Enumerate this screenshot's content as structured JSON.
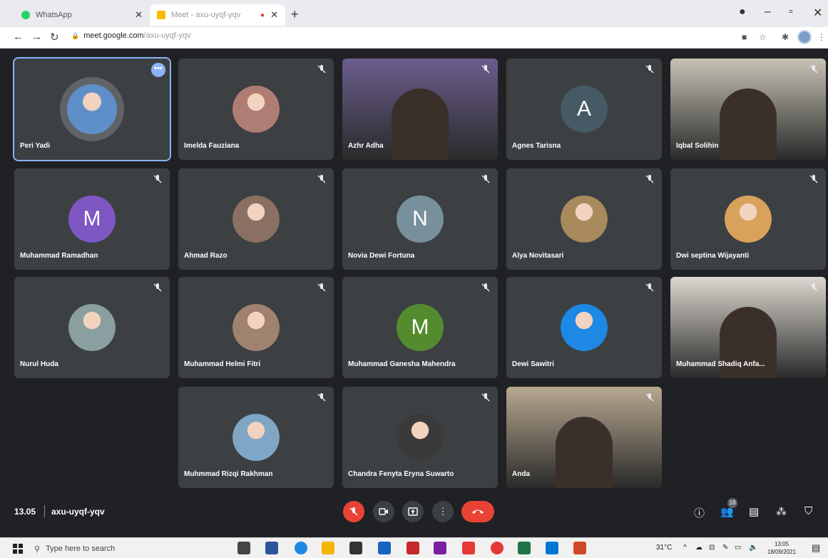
{
  "browser": {
    "tabs": [
      {
        "label": "WhatsApp",
        "active": false
      },
      {
        "label": "Meet - axu-uyqf-yqv",
        "active": true
      }
    ],
    "url_host": "meet.google.com",
    "url_path": "/axu-uyqf-yqv"
  },
  "meet": {
    "participants": [
      {
        "name": "Peri Yadi",
        "kind": "photo",
        "color": "#5f8fc9",
        "selected": true
      },
      {
        "name": "Imelda Fauziana",
        "kind": "photo",
        "color": "#b07d74"
      },
      {
        "name": "Azhr Adha",
        "kind": "video",
        "color": "#6a5d8c"
      },
      {
        "name": "Agnes Tarisna",
        "kind": "letter",
        "letter": "A",
        "color": "#455a64"
      },
      {
        "name": "Iqbal Solihin",
        "kind": "video",
        "color": "#c7c2b5"
      },
      {
        "name": "Muhammad Ramadhan",
        "kind": "letter",
        "letter": "M",
        "color": "#7e57c2"
      },
      {
        "name": "Ahmad Razo",
        "kind": "photo",
        "color": "#8a6f63"
      },
      {
        "name": "Novia Dewi Fortuna",
        "kind": "letter",
        "letter": "N",
        "color": "#78909c"
      },
      {
        "name": "Alya Novitasari",
        "kind": "photo",
        "color": "#a88a5d"
      },
      {
        "name": "Dwi septina Wijayanti",
        "kind": "photo",
        "color": "#d9a25c"
      },
      {
        "name": "Nurul Huda",
        "kind": "photo",
        "color": "#8aa0a0"
      },
      {
        "name": "Muhammad Helmi Fitri",
        "kind": "photo",
        "color": "#a08270"
      },
      {
        "name": "Muhammad Ganesha Mahendra",
        "kind": "letter",
        "letter": "M",
        "color": "#558b2f"
      },
      {
        "name": "Dewi Sawitri",
        "kind": "photo",
        "color": "#1e88e5"
      },
      {
        "name": "Muhammad Shadiq Anfa...",
        "kind": "video",
        "color": "#dcd7cf"
      },
      {
        "name": "Muhmmad Rizqi Rakhman",
        "kind": "photo",
        "color": "#7fa6c4"
      },
      {
        "name": "Chandra Fenyta Eryna Suwarto",
        "kind": "photo",
        "color": "#3a3a3a"
      },
      {
        "name": "Anda",
        "kind": "video",
        "color": "#b8a890"
      }
    ],
    "time": "13.05",
    "meeting_code": "axu-uyqf-yqv",
    "participant_count": "18",
    "controls": [
      "mic-off",
      "camera",
      "present",
      "more",
      "end-call"
    ],
    "right_controls": [
      "info",
      "people",
      "chat",
      "activities",
      "host-controls"
    ]
  },
  "taskbar": {
    "search_placeholder": "Type here to search",
    "temperature": "31°C",
    "clock_time": "13:05",
    "clock_date": "18/09/2021"
  },
  "colors": {
    "meet_bg": "#202124",
    "tile_bg": "#3c4043",
    "end_red": "#ea4335",
    "accent_blue": "#8ab4f8"
  }
}
